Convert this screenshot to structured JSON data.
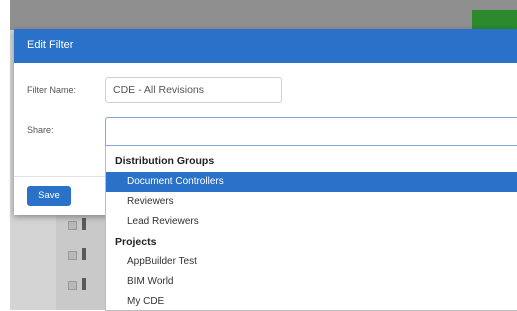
{
  "modal": {
    "title": "Edit Filter",
    "filter_name_label": "Filter Name:",
    "filter_name_value": "CDE - All Revisions",
    "share_label": "Share:",
    "share_value": "",
    "save_label": "Save"
  },
  "dropdown": {
    "groups": [
      {
        "label": "Distribution Groups",
        "options": [
          "Document Controllers",
          "Reviewers",
          "Lead Reviewers"
        ]
      },
      {
        "label": "Projects",
        "options": [
          "AppBuilder Test",
          "BIM World",
          "My CDE"
        ]
      }
    ],
    "selected": "Document Controllers"
  },
  "colors": {
    "header_blue": "#2a71c9",
    "selected_blue": "#2a71c9",
    "background_overlay": "#c9c9c9"
  }
}
